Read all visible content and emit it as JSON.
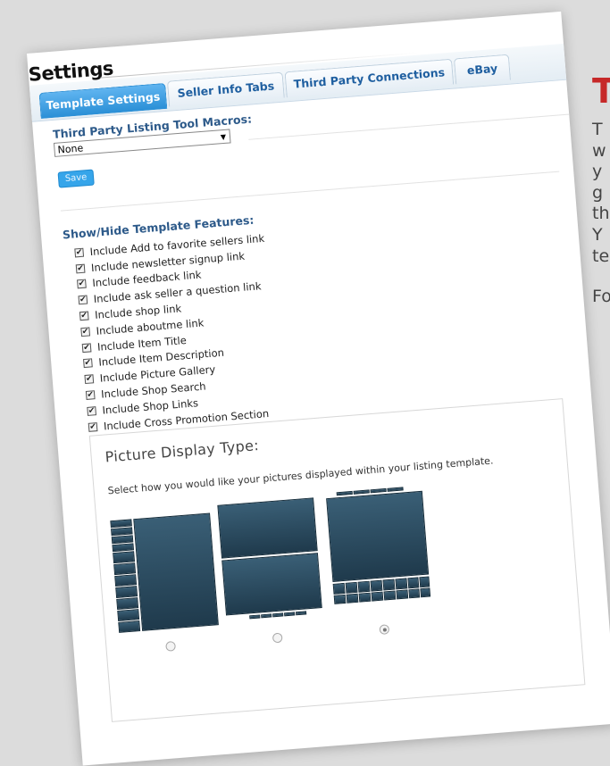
{
  "side": {
    "title": "T",
    "lines": [
      "T",
      "w",
      "y",
      "g",
      "th",
      "Y",
      "te"
    ],
    "footer": "Fo"
  },
  "settings": {
    "title": "Settings",
    "tabs": [
      {
        "label": "Template Settings",
        "active": true
      },
      {
        "label": "Seller Info Tabs",
        "active": false
      },
      {
        "label": "Third Party Connections",
        "active": false
      },
      {
        "label": "eBay",
        "active": false
      }
    ],
    "macros_label": "Third Party Listing Tool Macros:",
    "macros_value": "None",
    "save_label": "Save",
    "features_label": "Show/Hide Template Features:",
    "features": [
      {
        "label": "Include Add to favorite sellers link",
        "checked": true
      },
      {
        "label": "Include newsletter signup link",
        "checked": true
      },
      {
        "label": "Include feedback link",
        "checked": true
      },
      {
        "label": "Include ask seller a question link",
        "checked": true
      },
      {
        "label": "Include shop link",
        "checked": true
      },
      {
        "label": "Include aboutme link",
        "checked": true
      },
      {
        "label": "Include Item Title",
        "checked": true
      },
      {
        "label": "Include Item Description",
        "checked": true
      },
      {
        "label": "Include Picture Gallery",
        "checked": true
      },
      {
        "label": "Include Shop Search",
        "checked": true
      },
      {
        "label": "Include Shop Links",
        "checked": true
      },
      {
        "label": "Include Cross Promotion Section",
        "checked": true
      }
    ],
    "picture_display": {
      "title": "Picture Display Type:",
      "description": "Select how you would like your pictures displayed within your listing template.",
      "selected": 3,
      "options": [
        "layout-1",
        "layout-2",
        "layout-3"
      ]
    }
  },
  "colors": {
    "title_accent": "#c62828",
    "active_tab": "#2a8fd6",
    "save_button": "#36a5ea"
  }
}
